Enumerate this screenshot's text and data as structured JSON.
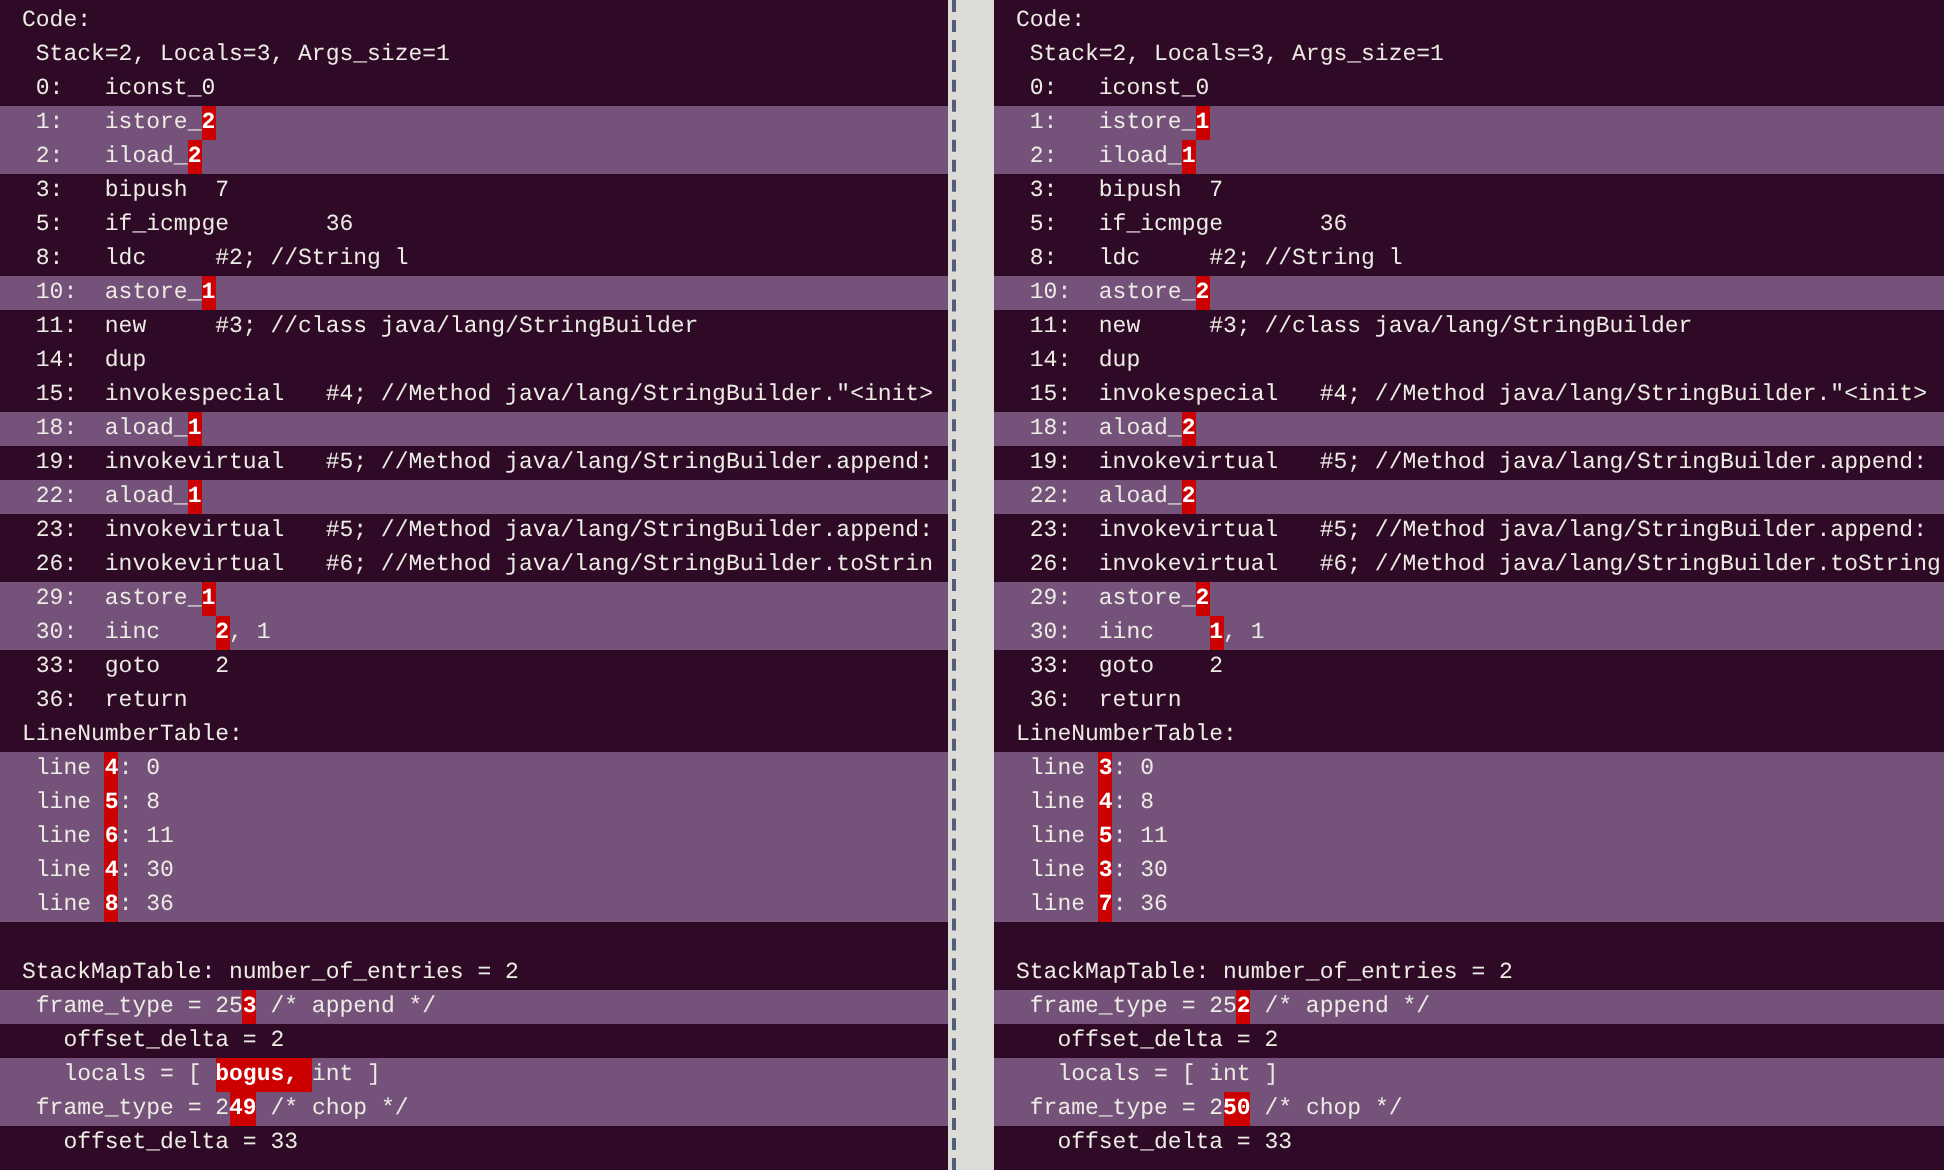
{
  "panes": [
    {
      "lines": [
        {
          "changed": false,
          "parts": [
            {
              "text": "Code:",
              "diff": false
            }
          ]
        },
        {
          "changed": false,
          "parts": [
            {
              "text": " Stack=2, Locals=3, Args_size=1",
              "diff": false
            }
          ]
        },
        {
          "changed": false,
          "parts": [
            {
              "text": " 0:   iconst_0",
              "diff": false
            }
          ]
        },
        {
          "changed": true,
          "parts": [
            {
              "text": " 1:   istore_",
              "diff": false
            },
            {
              "text": "2",
              "diff": true
            }
          ]
        },
        {
          "changed": true,
          "parts": [
            {
              "text": " 2:   iload_",
              "diff": false
            },
            {
              "text": "2",
              "diff": true
            }
          ]
        },
        {
          "changed": false,
          "parts": [
            {
              "text": " 3:   bipush  7",
              "diff": false
            }
          ]
        },
        {
          "changed": false,
          "parts": [
            {
              "text": " 5:   if_icmpge       36",
              "diff": false
            }
          ]
        },
        {
          "changed": false,
          "parts": [
            {
              "text": " 8:   ldc     #2; //String l",
              "diff": false
            }
          ]
        },
        {
          "changed": true,
          "parts": [
            {
              "text": " 10:  astore_",
              "diff": false
            },
            {
              "text": "1",
              "diff": true
            }
          ]
        },
        {
          "changed": false,
          "parts": [
            {
              "text": " 11:  new     #3; //class java/lang/StringBuilder",
              "diff": false
            }
          ]
        },
        {
          "changed": false,
          "parts": [
            {
              "text": " 14:  dup",
              "diff": false
            }
          ]
        },
        {
          "changed": false,
          "parts": [
            {
              "text": " 15:  invokespecial   #4; //Method java/lang/StringBuilder.\"<init>",
              "diff": false
            }
          ]
        },
        {
          "changed": true,
          "parts": [
            {
              "text": " 18:  aload_",
              "diff": false
            },
            {
              "text": "1",
              "diff": true
            }
          ]
        },
        {
          "changed": false,
          "parts": [
            {
              "text": " 19:  invokevirtual   #5; //Method java/lang/StringBuilder.append:",
              "diff": false
            }
          ]
        },
        {
          "changed": true,
          "parts": [
            {
              "text": " 22:  aload_",
              "diff": false
            },
            {
              "text": "1",
              "diff": true
            }
          ]
        },
        {
          "changed": false,
          "parts": [
            {
              "text": " 23:  invokevirtual   #5; //Method java/lang/StringBuilder.append:",
              "diff": false
            }
          ]
        },
        {
          "changed": false,
          "parts": [
            {
              "text": " 26:  invokevirtual   #6; //Method java/lang/StringBuilder.toStrin",
              "diff": false
            }
          ]
        },
        {
          "changed": true,
          "parts": [
            {
              "text": " 29:  astore_",
              "diff": false
            },
            {
              "text": "1",
              "diff": true
            }
          ]
        },
        {
          "changed": true,
          "parts": [
            {
              "text": " 30:  iinc    ",
              "diff": false
            },
            {
              "text": "2",
              "diff": true
            },
            {
              "text": ", 1",
              "diff": false
            }
          ]
        },
        {
          "changed": false,
          "parts": [
            {
              "text": " 33:  goto    2",
              "diff": false
            }
          ]
        },
        {
          "changed": false,
          "parts": [
            {
              "text": " 36:  return",
              "diff": false
            }
          ]
        },
        {
          "changed": false,
          "parts": [
            {
              "text": "LineNumberTable:",
              "diff": false
            }
          ]
        },
        {
          "changed": true,
          "parts": [
            {
              "text": " line ",
              "diff": false
            },
            {
              "text": "4",
              "diff": true
            },
            {
              "text": ": 0",
              "diff": false
            }
          ]
        },
        {
          "changed": true,
          "parts": [
            {
              "text": " line ",
              "diff": false
            },
            {
              "text": "5",
              "diff": true
            },
            {
              "text": ": 8",
              "diff": false
            }
          ]
        },
        {
          "changed": true,
          "parts": [
            {
              "text": " line ",
              "diff": false
            },
            {
              "text": "6",
              "diff": true
            },
            {
              "text": ": 11",
              "diff": false
            }
          ]
        },
        {
          "changed": true,
          "parts": [
            {
              "text": " line ",
              "diff": false
            },
            {
              "text": "4",
              "diff": true
            },
            {
              "text": ": 30",
              "diff": false
            }
          ]
        },
        {
          "changed": true,
          "parts": [
            {
              "text": " line ",
              "diff": false
            },
            {
              "text": "8",
              "diff": true
            },
            {
              "text": ": 36",
              "diff": false
            }
          ]
        },
        {
          "changed": false
        },
        {
          "changed": false,
          "parts": [
            {
              "text": "StackMapTable: number_of_entries = 2",
              "diff": false
            }
          ]
        },
        {
          "changed": true,
          "parts": [
            {
              "text": " frame_type = 25",
              "diff": false
            },
            {
              "text": "3",
              "diff": true
            },
            {
              "text": " /* append */",
              "diff": false
            }
          ]
        },
        {
          "changed": false,
          "parts": [
            {
              "text": "   offset_delta = 2",
              "diff": false
            }
          ]
        },
        {
          "changed": true,
          "parts": [
            {
              "text": "   locals = [ ",
              "diff": false
            },
            {
              "text": "bogus, ",
              "diff": true
            },
            {
              "text": "int ]",
              "diff": false
            }
          ]
        },
        {
          "changed": true,
          "parts": [
            {
              "text": " frame_type = 2",
              "diff": false
            },
            {
              "text": "49",
              "diff": true
            },
            {
              "text": " /* chop */",
              "diff": false
            }
          ]
        },
        {
          "changed": false,
          "parts": [
            {
              "text": "   offset_delta = 33",
              "diff": false
            }
          ]
        }
      ]
    },
    {
      "lines": [
        {
          "changed": false,
          "parts": [
            {
              "text": "Code:",
              "diff": false
            }
          ]
        },
        {
          "changed": false,
          "parts": [
            {
              "text": " Stack=2, Locals=3, Args_size=1",
              "diff": false
            }
          ]
        },
        {
          "changed": false,
          "parts": [
            {
              "text": " 0:   iconst_0",
              "diff": false
            }
          ]
        },
        {
          "changed": true,
          "parts": [
            {
              "text": " 1:   istore_",
              "diff": false
            },
            {
              "text": "1",
              "diff": true
            }
          ]
        },
        {
          "changed": true,
          "parts": [
            {
              "text": " 2:   iload_",
              "diff": false
            },
            {
              "text": "1",
              "diff": true
            }
          ]
        },
        {
          "changed": false,
          "parts": [
            {
              "text": " 3:   bipush  7",
              "diff": false
            }
          ]
        },
        {
          "changed": false,
          "parts": [
            {
              "text": " 5:   if_icmpge       36",
              "diff": false
            }
          ]
        },
        {
          "changed": false,
          "parts": [
            {
              "text": " 8:   ldc     #2; //String l",
              "diff": false
            }
          ]
        },
        {
          "changed": true,
          "parts": [
            {
              "text": " 10:  astore_",
              "diff": false
            },
            {
              "text": "2",
              "diff": true
            }
          ]
        },
        {
          "changed": false,
          "parts": [
            {
              "text": " 11:  new     #3; //class java/lang/StringBuilder",
              "diff": false
            }
          ]
        },
        {
          "changed": false,
          "parts": [
            {
              "text": " 14:  dup",
              "diff": false
            }
          ]
        },
        {
          "changed": false,
          "parts": [
            {
              "text": " 15:  invokespecial   #4; //Method java/lang/StringBuilder.\"<init>",
              "diff": false
            }
          ]
        },
        {
          "changed": true,
          "parts": [
            {
              "text": " 18:  aload_",
              "diff": false
            },
            {
              "text": "2",
              "diff": true
            }
          ]
        },
        {
          "changed": false,
          "parts": [
            {
              "text": " 19:  invokevirtual   #5; //Method java/lang/StringBuilder.append:",
              "diff": false
            }
          ]
        },
        {
          "changed": true,
          "parts": [
            {
              "text": " 22:  aload_",
              "diff": false
            },
            {
              "text": "2",
              "diff": true
            }
          ]
        },
        {
          "changed": false,
          "parts": [
            {
              "text": " 23:  invokevirtual   #5; //Method java/lang/StringBuilder.append:",
              "diff": false
            }
          ]
        },
        {
          "changed": false,
          "parts": [
            {
              "text": " 26:  invokevirtual   #6; //Method java/lang/StringBuilder.toString",
              "diff": false
            }
          ]
        },
        {
          "changed": true,
          "parts": [
            {
              "text": " 29:  astore_",
              "diff": false
            },
            {
              "text": "2",
              "diff": true
            }
          ]
        },
        {
          "changed": true,
          "parts": [
            {
              "text": " 30:  iinc    ",
              "diff": false
            },
            {
              "text": "1",
              "diff": true
            },
            {
              "text": ", 1",
              "diff": false
            }
          ]
        },
        {
          "changed": false,
          "parts": [
            {
              "text": " 33:  goto    2",
              "diff": false
            }
          ]
        },
        {
          "changed": false,
          "parts": [
            {
              "text": " 36:  return",
              "diff": false
            }
          ]
        },
        {
          "changed": false,
          "parts": [
            {
              "text": "LineNumberTable:",
              "diff": false
            }
          ]
        },
        {
          "changed": true,
          "parts": [
            {
              "text": " line ",
              "diff": false
            },
            {
              "text": "3",
              "diff": true
            },
            {
              "text": ": 0",
              "diff": false
            }
          ]
        },
        {
          "changed": true,
          "parts": [
            {
              "text": " line ",
              "diff": false
            },
            {
              "text": "4",
              "diff": true
            },
            {
              "text": ": 8",
              "diff": false
            }
          ]
        },
        {
          "changed": true,
          "parts": [
            {
              "text": " line ",
              "diff": false
            },
            {
              "text": "5",
              "diff": true
            },
            {
              "text": ": 11",
              "diff": false
            }
          ]
        },
        {
          "changed": true,
          "parts": [
            {
              "text": " line ",
              "diff": false
            },
            {
              "text": "3",
              "diff": true
            },
            {
              "text": ": 30",
              "diff": false
            }
          ]
        },
        {
          "changed": true,
          "parts": [
            {
              "text": " line ",
              "diff": false
            },
            {
              "text": "7",
              "diff": true
            },
            {
              "text": ": 36",
              "diff": false
            }
          ]
        },
        {
          "changed": false
        },
        {
          "changed": false,
          "parts": [
            {
              "text": "StackMapTable: number_of_entries = 2",
              "diff": false
            }
          ]
        },
        {
          "changed": true,
          "parts": [
            {
              "text": " frame_type = 25",
              "diff": false
            },
            {
              "text": "2",
              "diff": true
            },
            {
              "text": " /* append */",
              "diff": false
            }
          ]
        },
        {
          "changed": false,
          "parts": [
            {
              "text": "   offset_delta = 2",
              "diff": false
            }
          ]
        },
        {
          "changed": true,
          "parts": [
            {
              "text": "   locals = [ int ]",
              "diff": false
            }
          ]
        },
        {
          "changed": true,
          "parts": [
            {
              "text": " frame_type = 2",
              "diff": false
            },
            {
              "text": "50",
              "diff": true
            },
            {
              "text": " /* chop */",
              "diff": false
            }
          ]
        },
        {
          "changed": false,
          "parts": [
            {
              "text": "   offset_delta = 33",
              "diff": false
            }
          ]
        }
      ]
    }
  ]
}
